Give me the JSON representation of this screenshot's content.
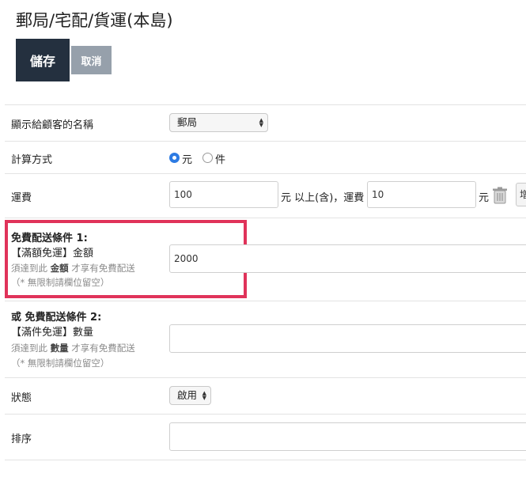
{
  "page_title": "郵局/宅配/貨運(本島)",
  "toolbar": {
    "save_label": "儲存",
    "cancel_label": "取消"
  },
  "display_name": {
    "label": "顯示給顧客的名稱",
    "selected": "郵局"
  },
  "calc_method": {
    "label": "計算方式",
    "option_yuan": "元",
    "option_piece": "件",
    "selected": "元"
  },
  "shipping_fee": {
    "label": "運費",
    "fee_value": "100",
    "middle_text": "元 以上(含)，運費",
    "fee_value2": "10",
    "unit": "元",
    "cut_button_label": "增"
  },
  "free_condition_1": {
    "title": "免費配送條件 1:",
    "subtitle": "【滿額免運】金額",
    "help_prefix": "須達到此 ",
    "help_keyword": "金額",
    "help_suffix": " 才享有免費配送",
    "note": "（* 無限制請欄位留空）",
    "value": "2000"
  },
  "free_condition_2": {
    "title": "或 免費配送條件 2:",
    "subtitle": "【滿件免運】數量",
    "help_prefix": "須達到此 ",
    "help_keyword": "數量",
    "help_suffix": " 才享有免費配送",
    "note": "（* 無限制請欄位留空）",
    "value": ""
  },
  "status": {
    "label": "狀態",
    "selected": "啟用"
  },
  "sort_order": {
    "label": "排序",
    "value": ""
  },
  "colors": {
    "save_bg": "#24303f",
    "cancel_bg": "#96a0ab",
    "highlight": "#e0335a",
    "radio_on": "#2d7be3"
  }
}
